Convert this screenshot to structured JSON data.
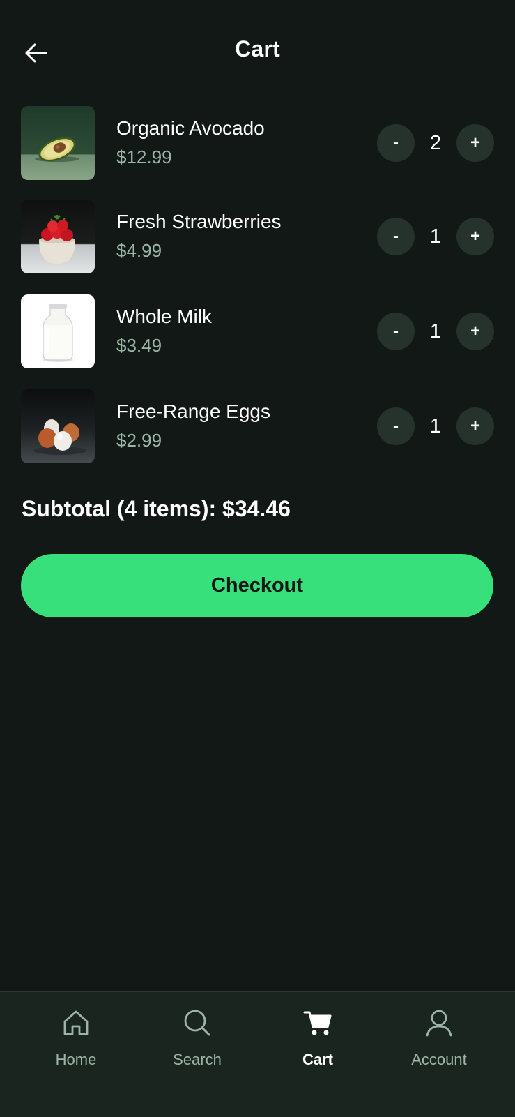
{
  "header": {
    "back_icon": "arrow-left-icon",
    "title": "Cart"
  },
  "cart": {
    "items": [
      {
        "name": "Organic Avocado",
        "price": "$12.99",
        "quantity": "2",
        "image": "avocado"
      },
      {
        "name": "Fresh Strawberries",
        "price": "$4.99",
        "quantity": "1",
        "image": "strawberries"
      },
      {
        "name": "Whole Milk",
        "price": "$3.49",
        "quantity": "1",
        "image": "milk"
      },
      {
        "name": "Free-Range Eggs",
        "price": "$2.99",
        "quantity": "1",
        "image": "eggs"
      }
    ],
    "minus_label": "-",
    "plus_label": "+"
  },
  "summary": {
    "subtotal": "Subtotal (4 items): $34.46",
    "checkout_label": "Checkout"
  },
  "nav": {
    "items": [
      {
        "label": "Home",
        "icon": "home-icon",
        "active": false
      },
      {
        "label": "Search",
        "icon": "search-icon",
        "active": false
      },
      {
        "label": "Cart",
        "icon": "cart-icon",
        "active": true
      },
      {
        "label": "Account",
        "icon": "account-icon",
        "active": false
      }
    ]
  },
  "colors": {
    "background": "#121816",
    "accent": "#38e07b",
    "muted_text": "#9db5a6",
    "button_bg": "#26332c",
    "nav_bg": "#1b2520"
  }
}
